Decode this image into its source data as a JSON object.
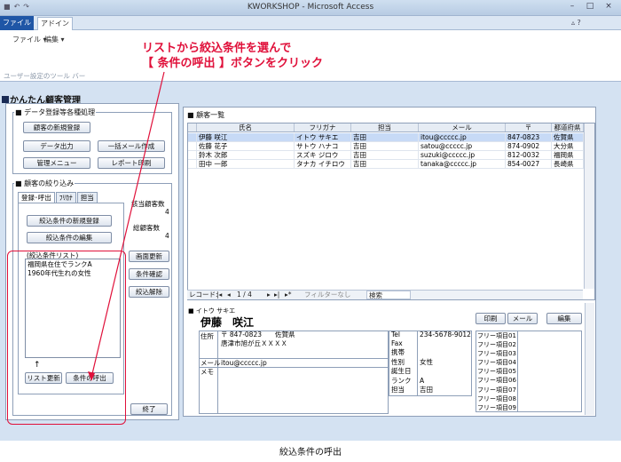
{
  "window": {
    "title": "KWORKSHOP - Microsoft Access"
  },
  "ribbon": {
    "file_tab": "ファイル",
    "addin_tab": "アドイン",
    "menu_file": "ファイル ▾",
    "menu_edit": "編集 ▾",
    "group_label": "ユーザー設定のツール バー"
  },
  "annotation": {
    "line1": "リストから絞込条件を選んで",
    "line2": "【 条件の呼出 】ボタンをクリック"
  },
  "form": {
    "title": "かんたん顧客管理"
  },
  "data_section": {
    "label": "データ登録等各種処理",
    "btn_new": "顧客の新規登録",
    "btn_export": "データ出力",
    "btn_bulkmail": "一括メール作成",
    "btn_admin": "管理メニュー",
    "btn_report": "レポート印刷"
  },
  "filter_section": {
    "label": "顧客の絞り込み",
    "tabs": [
      "登録･呼出",
      "ﾌﾘｶﾅ",
      "担当"
    ],
    "btn_new_cond": "絞込条件の新規登録",
    "btn_edit_cond": "絞込条件の編集",
    "list_header": "(絞込条件リスト)",
    "list_items": [
      "福岡県在住でランクA",
      "1960年代生れの女性"
    ],
    "arrow": "↑",
    "btn_refresh": "リスト更新",
    "btn_recall": "条件の呼出"
  },
  "counts": {
    "match_label": "該当顧客数",
    "match_value": "4",
    "total_label": "総顧客数",
    "total_value": "4"
  },
  "side_buttons": {
    "refresh": "画面更新",
    "confirm": "条件確認",
    "clear": "絞込解除",
    "exit": "終了"
  },
  "list": {
    "title": "顧客一覧",
    "columns": [
      "氏名",
      "フリガナ",
      "担当",
      "メール",
      "〒",
      "都道府県"
    ],
    "rows": [
      [
        "伊藤 咲江",
        "イトウ サキエ",
        "吉田",
        "itou@ccccc.jp",
        "847-0823",
        "佐賀県"
      ],
      [
        "佐藤 花子",
        "サトウ ハナコ",
        "吉田",
        "satou@ccccc.jp",
        "874-0902",
        "大分県"
      ],
      [
        "鈴木 次郎",
        "スズキ ジロウ",
        "吉田",
        "suzuki@ccccc.jp",
        "812-0032",
        "福岡県"
      ],
      [
        "田中 一郎",
        "タナカ イチロウ",
        "吉田",
        "tanaka@ccccc.jp",
        "854-0027",
        "長崎県"
      ]
    ],
    "nav": {
      "record_label": "レコード:",
      "first": "|◂",
      "prev": "◂",
      "position": "1 / 4",
      "next": "▸",
      "last": "▸|",
      "new": "▸*",
      "filter": "フィルターなし",
      "search": "検索"
    }
  },
  "detail": {
    "kana": "イトウ サキエ",
    "name": "伊藤　咲江",
    "btn_print": "印刷",
    "btn_mail": "メール",
    "btn_edit": "編集",
    "address_label": "住所",
    "zip": "〒 847-0823　　佐賀県",
    "address": "唐津市旭が丘ＸＸＸＸ",
    "mail_label": "メール",
    "mail": "itou@ccccc.jp",
    "memo_label": "メモ",
    "tel_label": "Tel",
    "tel": "234-5678-9012",
    "fax_label": "Fax",
    "mobile_label": "携帯",
    "gender_label": "性別",
    "gender": "女性",
    "birthday_label": "誕生日",
    "rank_label": "ランク",
    "rank": "A",
    "staff_label": "担当",
    "staff": "吉田",
    "free_items": [
      "フリー項目01",
      "フリー項目02",
      "フリー項目03",
      "フリー項目04",
      "フリー項目05",
      "フリー項目06",
      "フリー項目07",
      "フリー項目08",
      "フリー項目09"
    ]
  },
  "caption": "絞込条件の呼出",
  "colors": {
    "accent_red": "#e0103a",
    "file_tab": "#1f56a6",
    "form_bg": "#d4e2f2",
    "selected_row": "#c7daf6"
  }
}
